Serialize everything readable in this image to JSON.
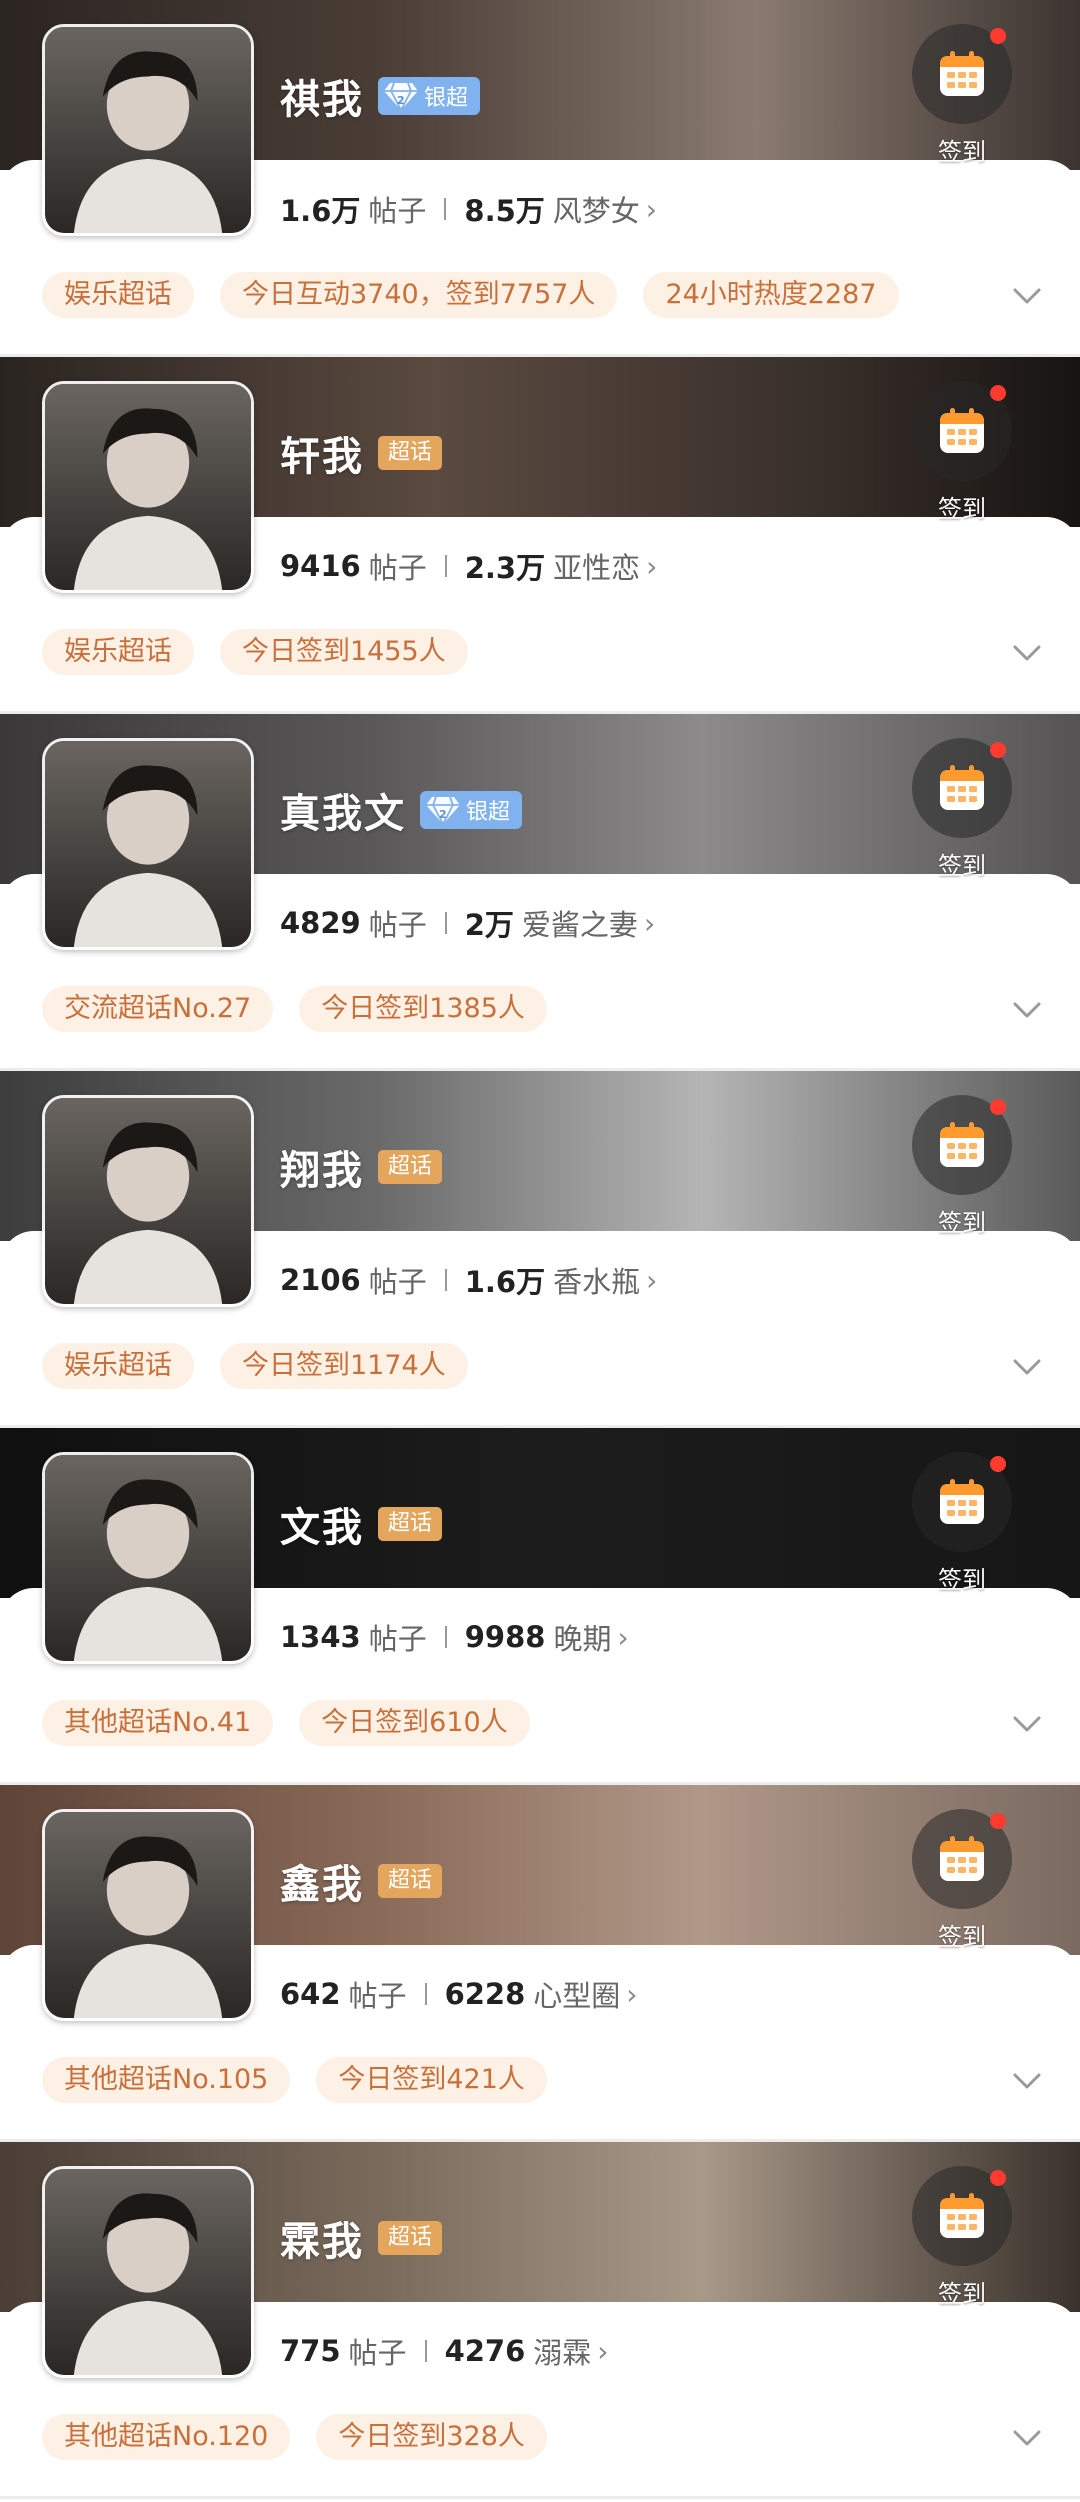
{
  "colors": {
    "tag_bg": "#fdf1e6",
    "tag_text": "#c9703a",
    "badge_silver": "#7fb2ee",
    "badge_chaohua": "#e4a65d",
    "notify_dot": "#ff3b30"
  },
  "cards": [
    {
      "name": "祺我",
      "badge_type": "silver",
      "badge_label": "银超",
      "checkin_label": "签到",
      "checkin_icon": "calendar-icon",
      "posts_num": "1.6万",
      "posts_label": "帖子",
      "fans_num": "8.5万",
      "fans_label": "风梦女",
      "tags": [
        "娱乐超话",
        "今日互动3740，签到7757人",
        "24小时热度2287"
      ],
      "banner_gradient": "linear-gradient(90deg,#2b2522 0%,#4a3d36 35%,#8a7a70 70%,#3b3430 100%)"
    },
    {
      "name": "轩我",
      "badge_type": "chaohua",
      "badge_label": "超话",
      "checkin_label": "签到",
      "checkin_icon": "calendar-icon",
      "posts_num": "9416",
      "posts_label": "帖子",
      "fans_num": "2.3万",
      "fans_label": "亚性恋",
      "tags": [
        "娱乐超话",
        "今日签到1455人"
      ],
      "banner_gradient": "linear-gradient(90deg,#2a2420 0%,#5a4a40 40%,#3a302b 75%,#171412 100%)"
    },
    {
      "name": "真我文",
      "badge_type": "silver",
      "badge_label": "银超",
      "checkin_label": "签到",
      "checkin_icon": "calendar-icon",
      "posts_num": "4829",
      "posts_label": "帖子",
      "fans_num": "2万",
      "fans_label": "爱酱之妻",
      "tags": [
        "交流超话No.27",
        "今日签到1385人"
      ],
      "banner_gradient": "linear-gradient(90deg,#3a3838 0%,#5a5858 35%,#8c8a8a 65%,#555353 100%)"
    },
    {
      "name": "翔我",
      "badge_type": "chaohua",
      "badge_label": "超话",
      "checkin_label": "签到",
      "checkin_icon": "calendar-icon",
      "posts_num": "2106",
      "posts_label": "帖子",
      "fans_num": "1.6万",
      "fans_label": "香水瓶",
      "tags": [
        "娱乐超话",
        "今日签到1174人"
      ],
      "banner_gradient": "linear-gradient(90deg,#3d3d3d 0%,#6a6a6a 35%,#b5b5b5 65%,#5a5a5a 100%)"
    },
    {
      "name": "文我",
      "badge_type": "chaohua",
      "badge_label": "超话",
      "checkin_label": "签到",
      "checkin_icon": "calendar-icon",
      "posts_num": "1343",
      "posts_label": "帖子",
      "fans_num": "9988",
      "fans_label": "晚期",
      "tags": [
        "其他超话No.41",
        "今日签到610人"
      ],
      "banner_gradient": "linear-gradient(90deg,#101010 0%,#1c1c1c 50%,#161616 100%)"
    },
    {
      "name": "鑫我",
      "badge_type": "chaohua",
      "badge_label": "超话",
      "checkin_label": "签到",
      "checkin_icon": "calendar-icon",
      "posts_num": "642",
      "posts_label": "帖子",
      "fans_num": "6228",
      "fans_label": "心型圈",
      "tags": [
        "其他超话No.105",
        "今日签到421人"
      ],
      "banner_gradient": "linear-gradient(90deg,#5e4538 0%,#8a6a58 35%,#b09888 65%,#7a6a60 100%)"
    },
    {
      "name": "霖我",
      "badge_type": "chaohua",
      "badge_label": "超话",
      "checkin_label": "签到",
      "checkin_icon": "calendar-icon",
      "posts_num": "775",
      "posts_label": "帖子",
      "fans_num": "4276",
      "fans_label": "溺霖",
      "tags": [
        "其他超话No.120",
        "今日签到328人"
      ],
      "banner_gradient": "linear-gradient(90deg,#4a3e36 0%,#7a6a5c 35%,#a89888 65%,#3a322c 100%)"
    }
  ]
}
